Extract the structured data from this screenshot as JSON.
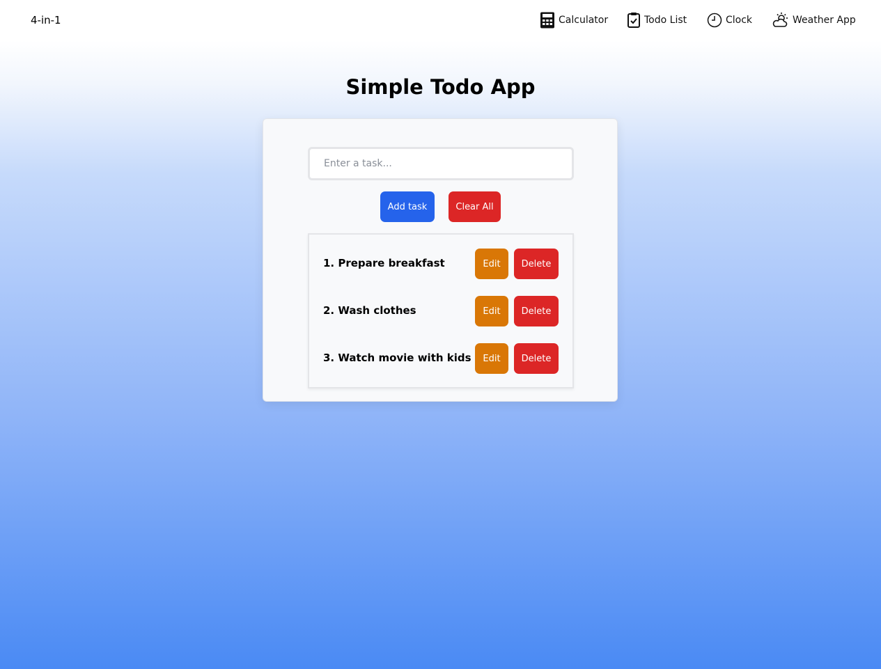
{
  "nav": {
    "brand": "4-in-1",
    "items": [
      {
        "label": "Calculator",
        "icon": "calculator-icon"
      },
      {
        "label": "Todo List",
        "icon": "clipboard-check-icon"
      },
      {
        "label": "Clock",
        "icon": "clock-icon"
      },
      {
        "label": "Weather App",
        "icon": "sun-cloud-icon"
      }
    ]
  },
  "page": {
    "title": "Simple Todo App"
  },
  "form": {
    "input_placeholder": "Enter a task...",
    "input_value": "",
    "add_label": "Add task",
    "clear_label": "Clear All"
  },
  "tasks": [
    {
      "text": "1. Prepare breakfast",
      "edit_label": "Edit",
      "delete_label": "Delete"
    },
    {
      "text": "2. Wash clothes",
      "edit_label": "Edit",
      "delete_label": "Delete"
    },
    {
      "text": "3. Watch movie with kids",
      "edit_label": "Edit",
      "delete_label": "Delete"
    }
  ],
  "colors": {
    "primary": "#2563eb",
    "danger": "#dc2626",
    "warning": "#d97706",
    "gradient_bottom": "#4a8af4"
  }
}
